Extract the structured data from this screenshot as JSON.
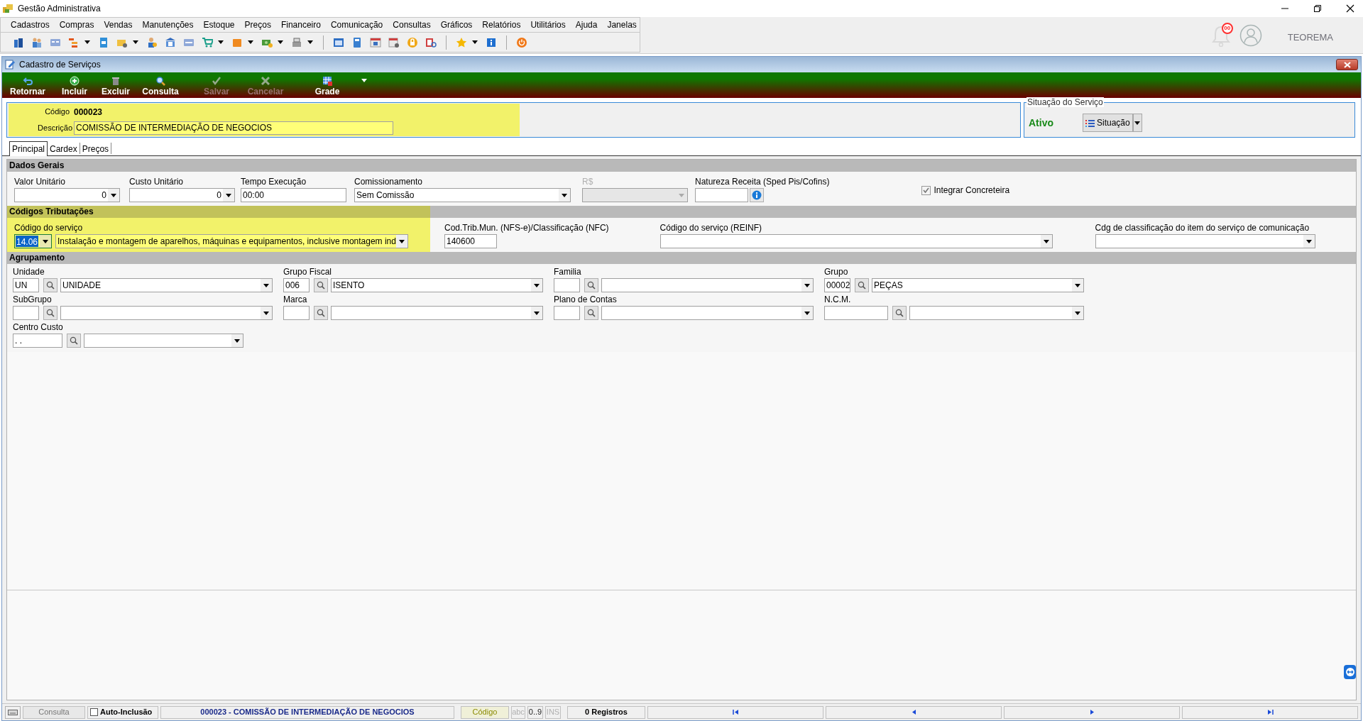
{
  "window": {
    "title": "Gestão Administrativa"
  },
  "menu": [
    "Cadastros",
    "Compras",
    "Vendas",
    "Manutenções",
    "Estoque",
    "Preços",
    "Financeiro",
    "Comunicação",
    "Consultas",
    "Gráficos",
    "Relatórios",
    "Utilitários",
    "Ajuda",
    "Janelas"
  ],
  "notifications": {
    "badge": "00"
  },
  "user": {
    "name": "TEOREMA"
  },
  "child_window": {
    "title": "Cadastro de Serviços"
  },
  "toolbar": [
    {
      "label": "Retornar",
      "disabled": false
    },
    {
      "label": "Incluir",
      "disabled": false
    },
    {
      "label": "Excluir",
      "disabled": false
    },
    {
      "label": "Consulta",
      "disabled": false
    },
    {
      "label": "Salvar",
      "disabled": true
    },
    {
      "label": "Cancelar",
      "disabled": true
    },
    {
      "label": "Grade",
      "disabled": false
    }
  ],
  "header": {
    "codigo_label": "Código",
    "codigo": "000023",
    "descricao_label": "Descrição",
    "descricao": "COMISSÃO DE INTERMEDIAÇÃO DE NEGOCIOS"
  },
  "situacao": {
    "title": "Situação do Serviço",
    "status": "Ativo",
    "button": "Situação"
  },
  "tabs": [
    {
      "label": "Principal",
      "selected": true
    },
    {
      "label": "Cardex",
      "selected": false
    },
    {
      "label": "Preços",
      "selected": false
    }
  ],
  "dados_gerais": {
    "title": "Dados Gerais",
    "fields": [
      {
        "kind": "number_combo",
        "label": "Valor Unitário",
        "value": "0",
        "disabled": false
      },
      {
        "kind": "number_combo",
        "label": "Custo Unitário",
        "value": "0",
        "disabled": false
      },
      {
        "kind": "text",
        "label": "Tempo Execução",
        "value": "00:00",
        "disabled": false
      },
      {
        "kind": "combo",
        "label": "Comissionamento",
        "value": "Sem Comissão",
        "disabled": false
      },
      {
        "kind": "combo",
        "label": "R$",
        "disabled": true
      },
      {
        "kind": "info_text",
        "label": "Natureza Receita (Sped Pis/Cofins)",
        "disabled": false
      },
      {
        "kind": "checkbox",
        "label": "Integrar Concreteira",
        "checked": true,
        "disabled": false
      }
    ]
  },
  "codigos_tributacoes": {
    "title": "Códigos Tributações",
    "fields": [
      {
        "kind": "code_combo",
        "label": "Código do serviço",
        "code": "14.06",
        "value": "Instalação e montagem de aparelhos, máquinas e equipamentos, inclusive montagem ind",
        "focused": true
      },
      {
        "kind": "text",
        "label": "Cod.Trib.Mun. (NFS-e)/Classificação (NFC)",
        "value": "140600",
        "focused": false
      },
      {
        "kind": "combo",
        "label": "Código do serviço (REINF)",
        "focused": false
      },
      {
        "kind": "combo",
        "label": "Cdg de classificação do item do serviço de comunicação",
        "focused": false
      }
    ]
  },
  "agrupamento": {
    "title": "Agrupamento",
    "fields": [
      {
        "label": "Unidade",
        "code": "UN",
        "value": "UNIDADE"
      },
      {
        "label": "Grupo Fiscal",
        "code": "006",
        "value": "ISENTO"
      },
      {
        "label": "Familia"
      },
      {
        "label": "Grupo",
        "code": "00002",
        "value": "PEÇAS"
      },
      {
        "label": "SubGrupo"
      },
      {
        "label": "Marca"
      },
      {
        "label": "Plano de Contas"
      },
      {
        "label": "N.C.M."
      },
      {
        "label": "Centro Custo",
        "code": ". ."
      }
    ]
  },
  "status_bar": {
    "mode": "Consulta",
    "auto_inclusao": {
      "label": "Auto-Inclusão",
      "checked": false
    },
    "record": "000023 - COMISSÃO DE INTERMEDIAÇÃO DE NEGOCIOS",
    "sort_field": "Código",
    "indicators": [
      {
        "label": "abc",
        "on": false
      },
      {
        "label": "0..9",
        "on": true
      },
      {
        "label": "INS",
        "on": false
      }
    ],
    "count": "0 Registros"
  }
}
